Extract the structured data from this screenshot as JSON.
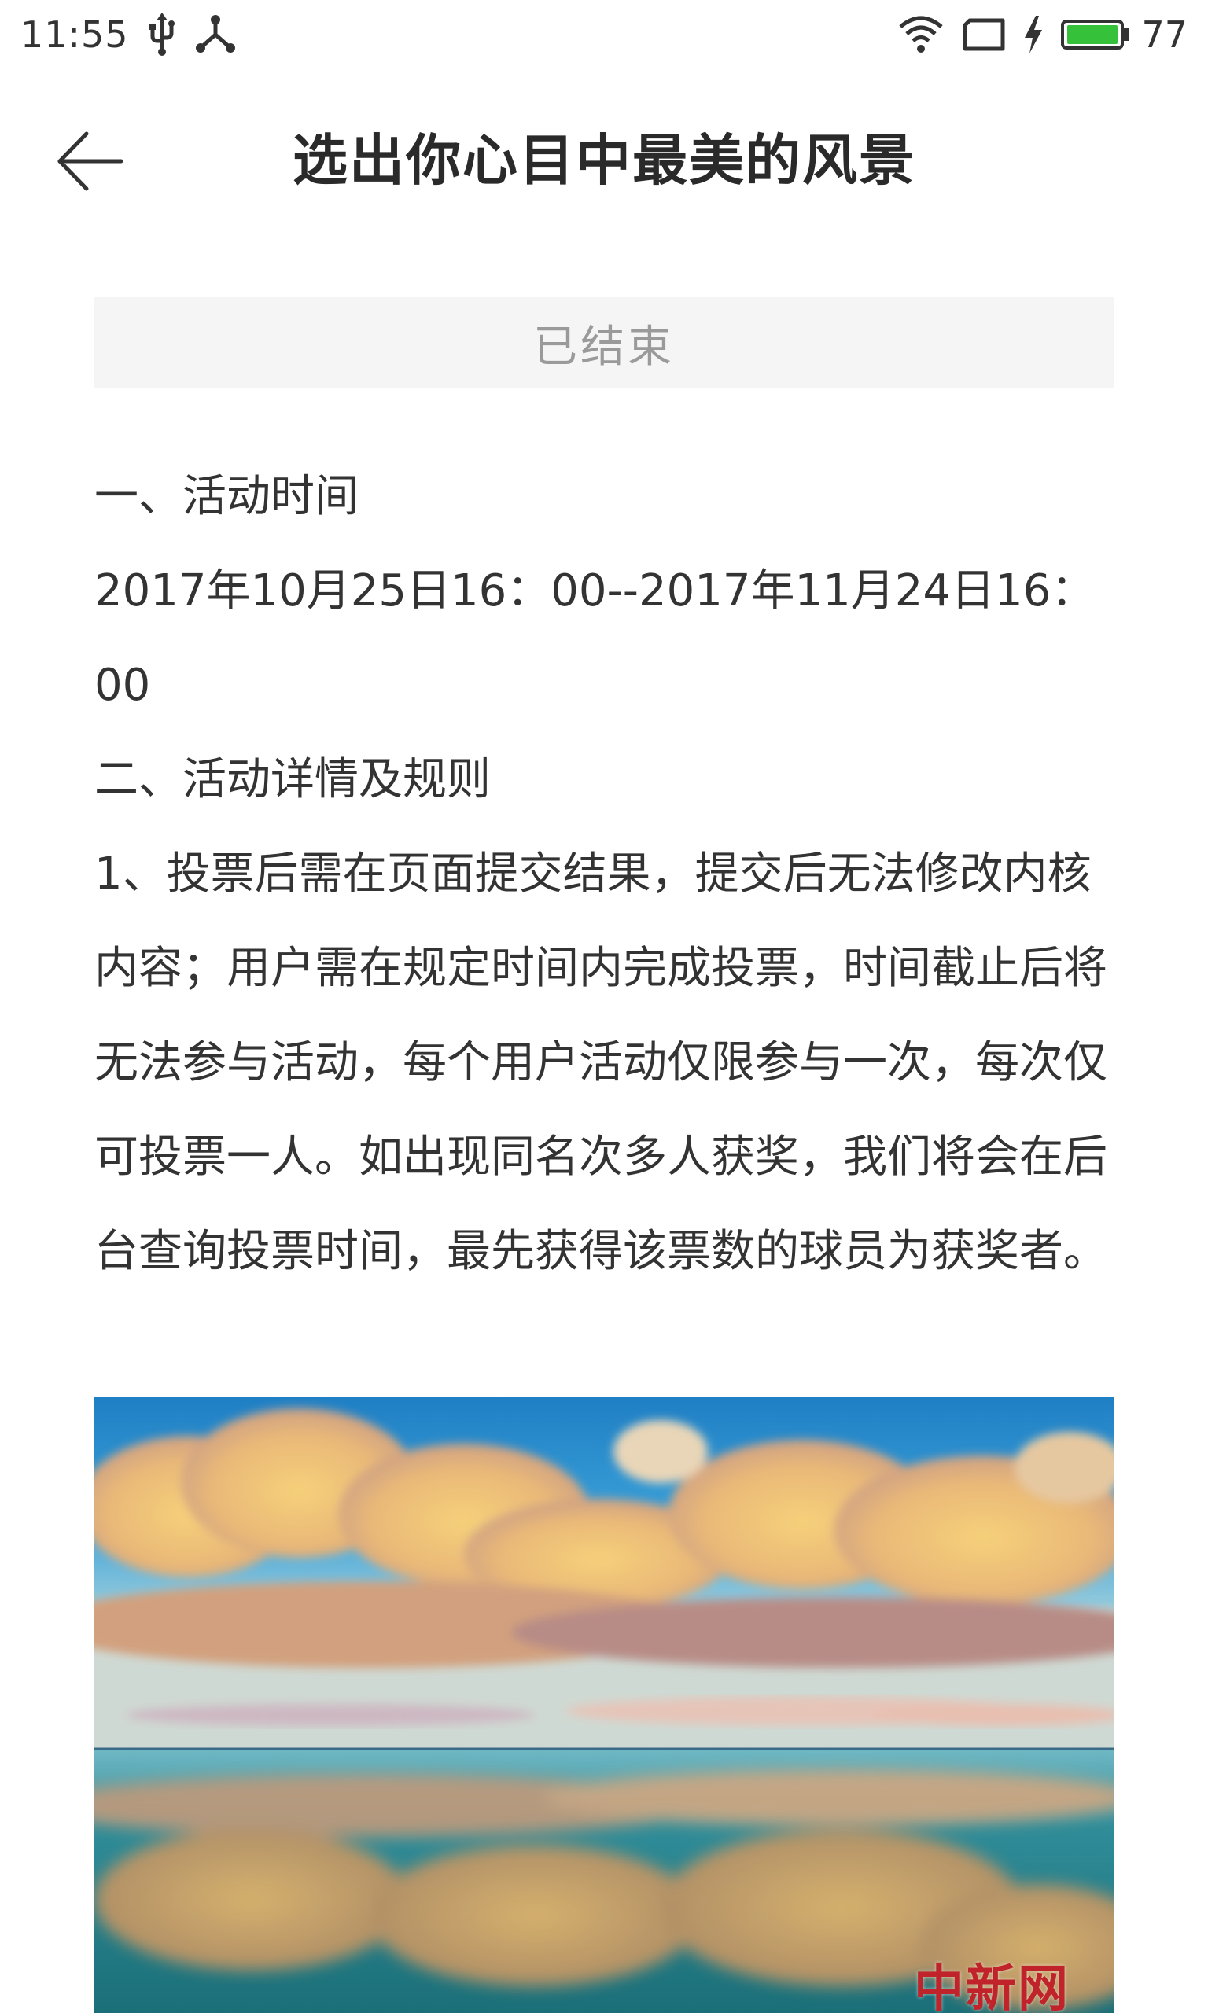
{
  "status_bar": {
    "time": "11:55",
    "icons": [
      "usb-icon",
      "share-icon",
      "wifi-icon",
      "screen-rotate-icon",
      "charging-icon",
      "battery-icon"
    ],
    "battery_level": "77",
    "battery_color": "#35c23a"
  },
  "header": {
    "title": "选出你心目中最美的风景",
    "back_icon": "back-arrow-icon"
  },
  "banner": {
    "status_text": "已结束",
    "background": "#f5f5f5",
    "text_color": "#9a9a9a"
  },
  "article": {
    "paragraphs": [
      "一、活动时间",
      "2017年10月25日16：00--2017年11月24日16：00",
      "二、活动详情及规则",
      "1、投票后需在页面提交结果，提交后无法修改内核内容；用户需在规定时间内完成投票，时间截止后将无法参与活动，每个用户活动仅限参与一次，每次仅可投票一人。如出现同名次多人获奖，我们将会在后台查询投票时间，最先获得该票数的球员为获奖者。"
    ]
  },
  "image": {
    "watermark": "中新网"
  }
}
